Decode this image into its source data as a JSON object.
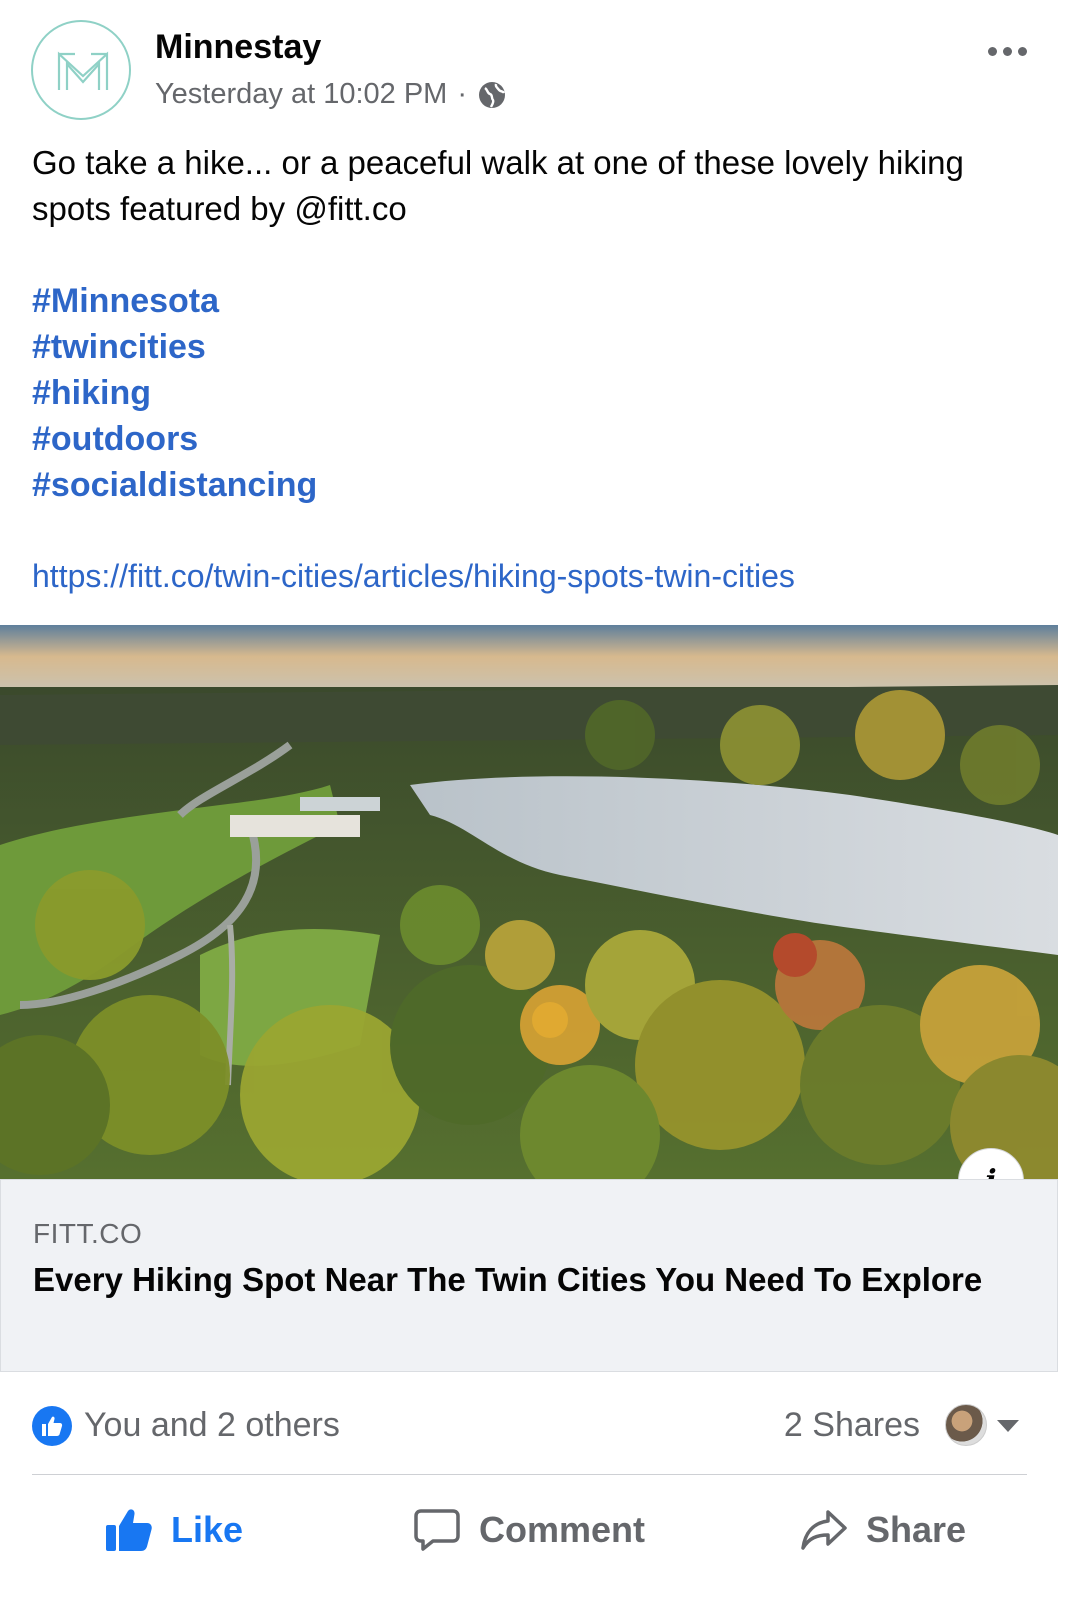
{
  "post": {
    "page_name": "Minnestay",
    "timestamp": "Yesterday at 10:02 PM",
    "separator": "·",
    "audience_icon": "globe-icon",
    "more_icon": "ellipsis-icon",
    "body": "Go take a hike... or a peaceful walk at one of these lovely hiking spots featured by @fitt.co",
    "hashtags": [
      "#Minnesota",
      "#twincities",
      "#hiking",
      "#outdoors",
      "#socialdistancing"
    ],
    "link_url": "https://fitt.co/twin-cities/articles/hiking-spots-twin-cities"
  },
  "link_preview": {
    "image_description_icon": "landscape-photo",
    "info_icon": "i",
    "domain": "FITT.CO",
    "title": "Every Hiking Spot Near The Twin Cities You Need To Explore"
  },
  "stats": {
    "reactions_text": "You and 2 others",
    "shares_text": "2 Shares"
  },
  "actions": {
    "like_label": "Like",
    "comment_label": "Comment",
    "share_label": "Share"
  },
  "colors": {
    "link_blue": "#2d66c8",
    "like_blue": "#1877f2",
    "secondary_text": "#65676b",
    "card_bg": "#f0f2f5"
  }
}
